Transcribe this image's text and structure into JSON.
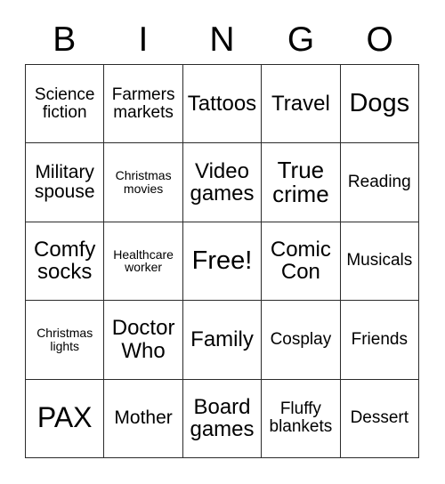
{
  "card": {
    "title": "Bingo Card",
    "header_letters": [
      "B",
      "I",
      "N",
      "G",
      "O"
    ],
    "columns": 5,
    "rows": 5,
    "colors": {
      "background": "#ffffff",
      "cell_background": "#ffffff",
      "border": "#2b2b2b",
      "text": "#000000"
    },
    "cells": [
      {
        "text": "Science fiction",
        "size": "sm"
      },
      {
        "text": "Farmers markets",
        "size": "sm"
      },
      {
        "text": "Tattoos",
        "size": "lg"
      },
      {
        "text": "Travel",
        "size": "lg"
      },
      {
        "text": "Dogs",
        "size": "xxl"
      },
      {
        "text": "Military spouse",
        "size": "md"
      },
      {
        "text": "Christmas movies",
        "size": "xs"
      },
      {
        "text": "Video games",
        "size": "lg"
      },
      {
        "text": "True crime",
        "size": "xl"
      },
      {
        "text": "Reading",
        "size": "sm"
      },
      {
        "text": "Comfy socks",
        "size": "lg"
      },
      {
        "text": "Healthcare worker",
        "size": "xs"
      },
      {
        "text": "Free!",
        "size": "xxl"
      },
      {
        "text": "Comic Con",
        "size": "lg"
      },
      {
        "text": "Musicals",
        "size": "sm"
      },
      {
        "text": "Christmas lights",
        "size": "xs"
      },
      {
        "text": "Doctor Who",
        "size": "lg"
      },
      {
        "text": "Family",
        "size": "lg"
      },
      {
        "text": "Cosplay",
        "size": "sm"
      },
      {
        "text": "Friends",
        "size": "sm"
      },
      {
        "text": "PAX",
        "size": "huge"
      },
      {
        "text": "Mother",
        "size": "md"
      },
      {
        "text": "Board games",
        "size": "lg"
      },
      {
        "text": "Fluffy blankets",
        "size": "sm"
      },
      {
        "text": "Dessert",
        "size": "sm"
      }
    ],
    "free_space_index": 12
  }
}
